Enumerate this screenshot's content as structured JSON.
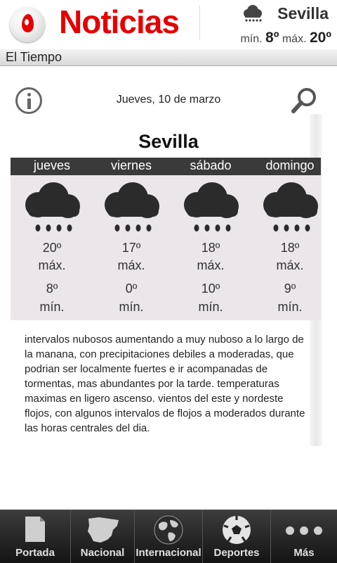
{
  "header": {
    "app_title": "Noticias",
    "city": "Sevilla",
    "min_label": "mín.",
    "min_value": "8º",
    "max_label": "máx.",
    "max_value": "20º",
    "weather_icon": "rain-cloud-icon"
  },
  "section": {
    "title": "El Tiempo"
  },
  "content": {
    "date": "Jueves, 10 de marzo",
    "city": "Sevilla",
    "forecast": [
      {
        "day": "jueves",
        "max": "20º",
        "max_label": "máx.",
        "min": "8º",
        "min_label": "mín.",
        "icon": "rain-cloud-icon"
      },
      {
        "day": "viernes",
        "max": "17º",
        "max_label": "máx.",
        "min": "0º",
        "min_label": "mín.",
        "icon": "rain-cloud-icon"
      },
      {
        "day": "sábado",
        "max": "18º",
        "max_label": "máx.",
        "min": "10º",
        "min_label": "mín.",
        "icon": "rain-cloud-icon"
      },
      {
        "day": "domingo",
        "max": "18º",
        "max_label": "máx.",
        "min": "9º",
        "min_label": "mín.",
        "icon": "rain-cloud-icon"
      }
    ],
    "description": "intervalos nubosos aumentando a muy nuboso a lo largo de la manana, con precipitaciones debiles a moderadas, que podrian ser localmente fuertes e ir acompanadas de tormentas, mas abundantes por la tarde. temperaturas maximas en ligero ascenso. vientos del este y nordeste flojos, con algunos intervalos de flojos a moderados durante las horas centrales del dia."
  },
  "nav": {
    "items": [
      {
        "label": "Portada",
        "icon": "document-icon"
      },
      {
        "label": "Nacional",
        "icon": "spain-map-icon"
      },
      {
        "label": "Internacional",
        "icon": "globe-icon"
      },
      {
        "label": "Deportes",
        "icon": "soccer-ball-icon"
      },
      {
        "label": "Más",
        "icon": "more-dots-icon"
      }
    ]
  },
  "colors": {
    "brand": "#e60000",
    "days_bar": "#3a3a3a",
    "forecast_bg": "#eae6ea",
    "nav_bg": "#1e1e1e"
  }
}
